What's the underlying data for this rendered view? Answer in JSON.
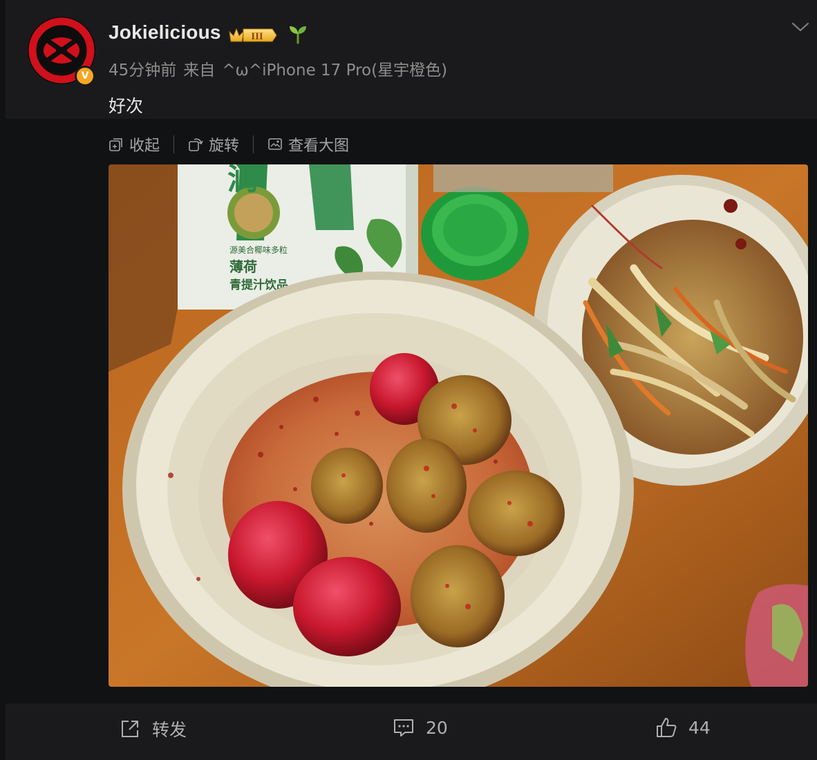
{
  "post": {
    "username": "Jokielicious",
    "level_badge": "III",
    "time": "45分钟前",
    "source_prefix": "来自",
    "source": "^ω^iPhone 17 Pro(星宇橙色)",
    "text": "好次"
  },
  "toolbar": {
    "collapse": "收起",
    "rotate": "旋转",
    "view_large": "查看大图"
  },
  "photo_labels": {
    "brand_char": "润",
    "pack_line1": "薄荷",
    "pack_line2": "青提汁饮品",
    "pack_small": "源美合椰味多粒"
  },
  "actions": {
    "repost": "转发",
    "comments": "20",
    "likes": "44"
  },
  "colors": {
    "page_bg": "#111214",
    "card_bg": "#1a1a1c",
    "verified_badge": "#f5a623",
    "avatar_red": "#d0101a"
  },
  "icons": {
    "verified": "verified-v-icon",
    "level": "crown-level-icon",
    "sprout": "sprout-icon",
    "menu": "chevron-down-icon",
    "collapse": "collapse-icon",
    "rotate": "rotate-icon",
    "view_large": "image-view-icon",
    "repost": "repost-icon",
    "comment": "comment-icon",
    "like": "thumbs-up-icon"
  }
}
